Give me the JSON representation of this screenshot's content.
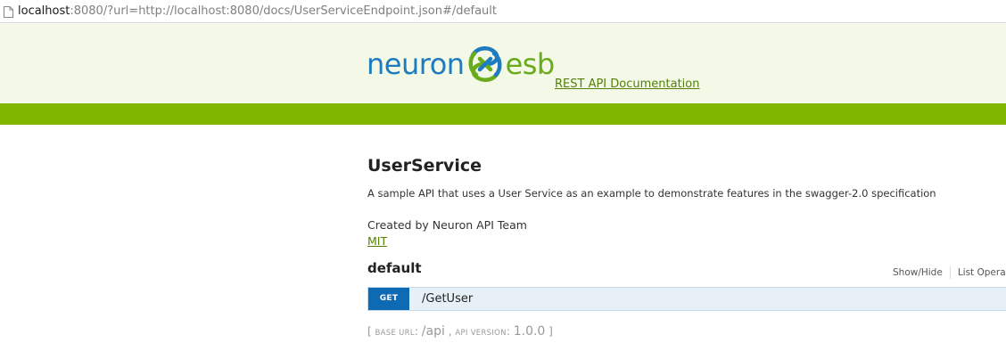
{
  "browser": {
    "url_host": "localhost",
    "url_rest": ":8080/?url=http://localhost:8080/docs/UserServiceEndpoint.json#/default"
  },
  "header": {
    "logo_text_left": "neuron",
    "logo_text_right": "esb",
    "rest_api_link": "REST API Documentation",
    "accent_green": "#80b500",
    "brand_blue": "#1d7cbf"
  },
  "api": {
    "title": "UserService",
    "description": "A sample API that uses a User Service as an example to demonstrate features in the swagger-2.0 specification",
    "created_by": "Created by Neuron API Team",
    "license": "MIT"
  },
  "resource": {
    "name": "default",
    "show_hide": "Show/Hide",
    "list_operations": "List Opera",
    "operations": [
      {
        "method": "GET",
        "path": "/GetUser",
        "method_color": "#0f6ab4"
      }
    ]
  },
  "footer": {
    "open_bracket": "[",
    "base_url_label": "BASE URL",
    "base_url_sep": ":",
    "base_url_value": "/api",
    "comma": ",",
    "api_version_label": "API VERSION",
    "api_version_sep": ":",
    "api_version_value": "1.0.0",
    "close_bracket": "]"
  }
}
